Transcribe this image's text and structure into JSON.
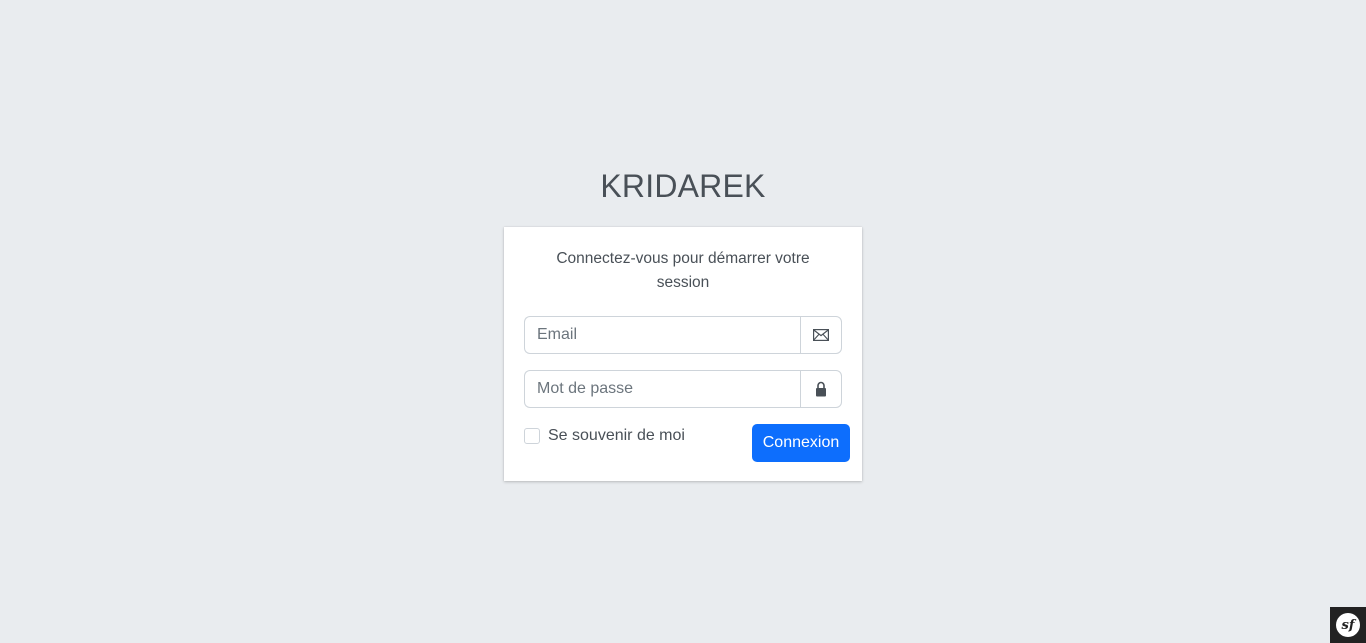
{
  "logo": {
    "text": "KRIDAREK"
  },
  "login": {
    "message": "Connectez-vous pour démarrer votre session",
    "email_placeholder": "Email",
    "email_icon": "envelope-icon",
    "password_placeholder": "Mot de passe",
    "password_icon": "lock-icon",
    "remember_label": "Se souvenir de moi",
    "submit_label": "Connexion"
  },
  "debug_toolbar": {
    "icon": "symfony-logo-icon",
    "text": "sf"
  },
  "colors": {
    "background": "#e9ecef",
    "primary": "#0d6efd",
    "text": "#495057"
  }
}
